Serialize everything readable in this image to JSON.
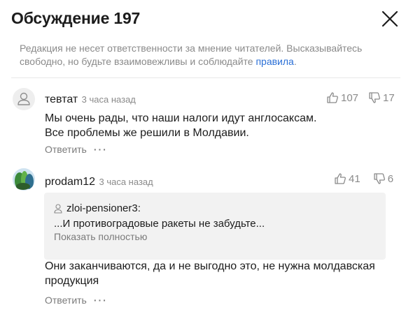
{
  "header": {
    "title": "Обсуждение 197"
  },
  "notice": {
    "text": "Редакция не несет ответственности за мнение читателей. Высказывайтесь свободно, но будьте взаимовежливы и соблюдайте ",
    "link": "правила",
    "end": "."
  },
  "comments": [
    {
      "author": "тевтат",
      "time": "3 часа назад",
      "likes": "107",
      "dislikes": "17",
      "lines": [
        "Мы очень рады, что наши налоги идут англосаксам.",
        "Все проблемы же решили в Молдавии."
      ],
      "reply_label": "Ответить",
      "more_label": "···"
    },
    {
      "author": "prodam12",
      "time": "3 часа назад",
      "likes": "41",
      "dislikes": "6",
      "quote": {
        "author": "zloi-pensioner3:",
        "text": "...И противоградовые ракеты не забудьте...",
        "show_more": "Показать полностью"
      },
      "lines": [
        "Они заканчиваются, да и не выгодно это, не нужна молдавская",
        "продукция"
      ],
      "reply_label": "Ответить",
      "more_label": "···"
    }
  ],
  "colors": {
    "link": "#2a6fd6",
    "muted": "#8a8a8a",
    "quote_bg": "#f2f2f2"
  }
}
